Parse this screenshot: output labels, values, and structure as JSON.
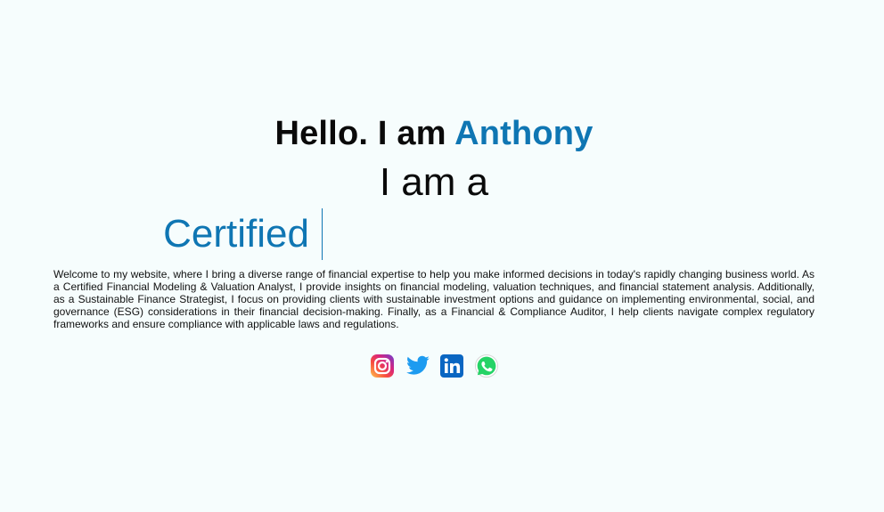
{
  "hero": {
    "greeting": "Hello. I am ",
    "name": "Anthony",
    "intro": "I am a",
    "typed_word": "Certified"
  },
  "bio": "Welcome to my website, where I bring a diverse range of financial expertise to help you make informed decisions in today's rapidly changing business world. As a Certified Financial Modeling & Valuation Analyst, I provide insights on financial modeling, valuation techniques, and financial statement analysis. Additionally, as a Sustainable Finance Strategist, I focus on providing clients with sustainable investment options and guidance on implementing environmental, social, and governance (ESG) considerations in their financial decision-making. Finally, as a Financial & Compliance Auditor, I help clients navigate complex regulatory frameworks and ensure compliance with applicable laws and regulations.",
  "social": [
    {
      "icon": "instagram-icon"
    },
    {
      "icon": "twitter-icon"
    },
    {
      "icon": "linkedin-icon"
    },
    {
      "icon": "whatsapp-icon"
    }
  ],
  "colors": {
    "background": "#f6fdfd",
    "accent": "#0f76b3",
    "text": "#0a0a0a"
  }
}
